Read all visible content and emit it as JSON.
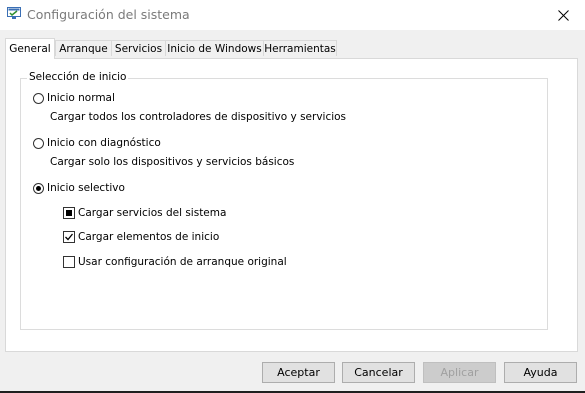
{
  "window": {
    "title": "Configuración del sistema"
  },
  "tabs": [
    {
      "label": "General",
      "active": true
    },
    {
      "label": "Arranque",
      "active": false
    },
    {
      "label": "Servicios",
      "active": false
    },
    {
      "label": "Inicio de Windows",
      "active": false
    },
    {
      "label": "Herramientas",
      "active": false
    }
  ],
  "startup_selection": {
    "legend": "Selección de inicio",
    "options": [
      {
        "label": "Inicio normal",
        "description": "Cargar todos los controladores de dispositivo y servicios",
        "selected": false
      },
      {
        "label": "Inicio con diagnóstico",
        "description": "Cargar solo los dispositivos y servicios básicos",
        "selected": false
      },
      {
        "label": "Inicio selectivo",
        "description": "",
        "selected": true
      }
    ],
    "selective_items": [
      {
        "label": "Cargar servicios del sistema",
        "state": "indeterminate"
      },
      {
        "label": "Cargar elementos de inicio",
        "state": "checked"
      },
      {
        "label": "Usar configuración de arranque original",
        "state": "unchecked"
      }
    ]
  },
  "buttons": {
    "ok": "Aceptar",
    "cancel": "Cancelar",
    "apply": "Aplicar",
    "help": "Ayuda"
  },
  "icons": {
    "app": "msconfig-icon",
    "close": "close-icon"
  },
  "colors": {
    "window_bg": "#f0f0f0",
    "panel_bg": "#ffffff",
    "title_text": "#7a7a7a",
    "disabled_text": "#a0a0a0"
  }
}
